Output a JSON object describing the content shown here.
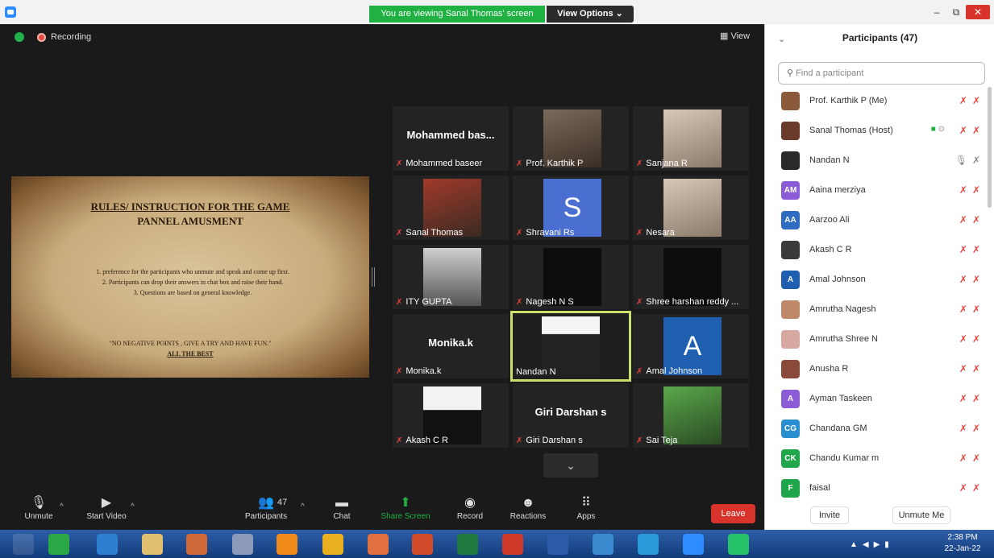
{
  "window": {
    "banner": "You are viewing Sanal Thomas' screen",
    "view_options": "View Options ⌄",
    "min": "–",
    "max": "⧉",
    "close": "✕"
  },
  "meeting": {
    "recording": "Recording",
    "view": "View"
  },
  "slide": {
    "title1": "RULES/ INSTRUCTION FOR THE GAME",
    "title2": "PANNEL AMUSMENT",
    "rule1": "1. preference for the participants who unmute and speak and come up first.",
    "rule2": "2. Participants can drop their answers in chat box and raise their hand.",
    "rule3": "3. Questions are based on general knowledge.",
    "footer1": "\"NO NEGATIVE POINTS , GIVE A TRY AND HAVE FUN.\"",
    "footer2": "ALL THE BEST"
  },
  "tiles": [
    {
      "name": "Mohammed baseer",
      "big": "Mohammed bas..."
    },
    {
      "name": "Prof. Karthik P"
    },
    {
      "name": "Sanjana R"
    },
    {
      "name": "Sanal Thomas"
    },
    {
      "name": "Shravani Rs",
      "letter": "S"
    },
    {
      "name": "Nesara"
    },
    {
      "name": "ITY GUPTA"
    },
    {
      "name": "Nagesh N S"
    },
    {
      "name": "Shree harshan reddy ..."
    },
    {
      "name": "Monika.k",
      "big": "Monika.k"
    },
    {
      "name": "Nandan N"
    },
    {
      "name": "Amal Johnson",
      "letter": "A"
    },
    {
      "name": "Akash C R"
    },
    {
      "name": "Giri Darshan s",
      "big": "Giri Darshan s"
    },
    {
      "name": "Sai Teja"
    }
  ],
  "toolbar": {
    "unmute": "Unmute",
    "start_video": "Start Video",
    "participants": "Participants",
    "participants_count": "47",
    "chat": "Chat",
    "share_screen": "Share Screen",
    "record": "Record",
    "reactions": "Reactions",
    "apps": "Apps",
    "leave": "Leave"
  },
  "panel": {
    "title": "Participants (47)",
    "search_placeholder": "Find a participant",
    "invite": "Invite",
    "unmute_me": "Unmute Me",
    "participants": [
      {
        "name": "Prof. Karthik P (Me)",
        "avatar": "",
        "color": "#8a5a3a"
      },
      {
        "name": "Sanal Thomas (Host)",
        "avatar": "",
        "color": "#6a3a2a"
      },
      {
        "name": "Nandan N",
        "avatar": "",
        "color": "#2a2a2a"
      },
      {
        "name": "Aaina merziya",
        "avatar": "AM",
        "color": "#8b5cd6"
      },
      {
        "name": "Aarzoo Ali",
        "avatar": "AA",
        "color": "#2d6cc0"
      },
      {
        "name": "Akash C R",
        "avatar": "",
        "color": "#3a3a3a"
      },
      {
        "name": "Amal Johnson",
        "avatar": "A",
        "color": "#1f5fb0"
      },
      {
        "name": "Amrutha Nagesh",
        "avatar": "",
        "color": "#c08a6a"
      },
      {
        "name": "Amrutha Shree N",
        "avatar": "",
        "color": "#d6a8a0"
      },
      {
        "name": "Anusha R",
        "avatar": "",
        "color": "#8a4a3a"
      },
      {
        "name": "Ayman Taskeen",
        "avatar": "A",
        "color": "#8b5cd6"
      },
      {
        "name": "Chandana GM",
        "avatar": "CG",
        "color": "#2a8fd0"
      },
      {
        "name": "Chandu Kumar m",
        "avatar": "CK",
        "color": "#1fa64a"
      },
      {
        "name": "faisal",
        "avatar": "F",
        "color": "#1fa64a"
      }
    ]
  },
  "taskbar": {
    "time": "2:38 PM",
    "date": "22-Jan-22"
  }
}
